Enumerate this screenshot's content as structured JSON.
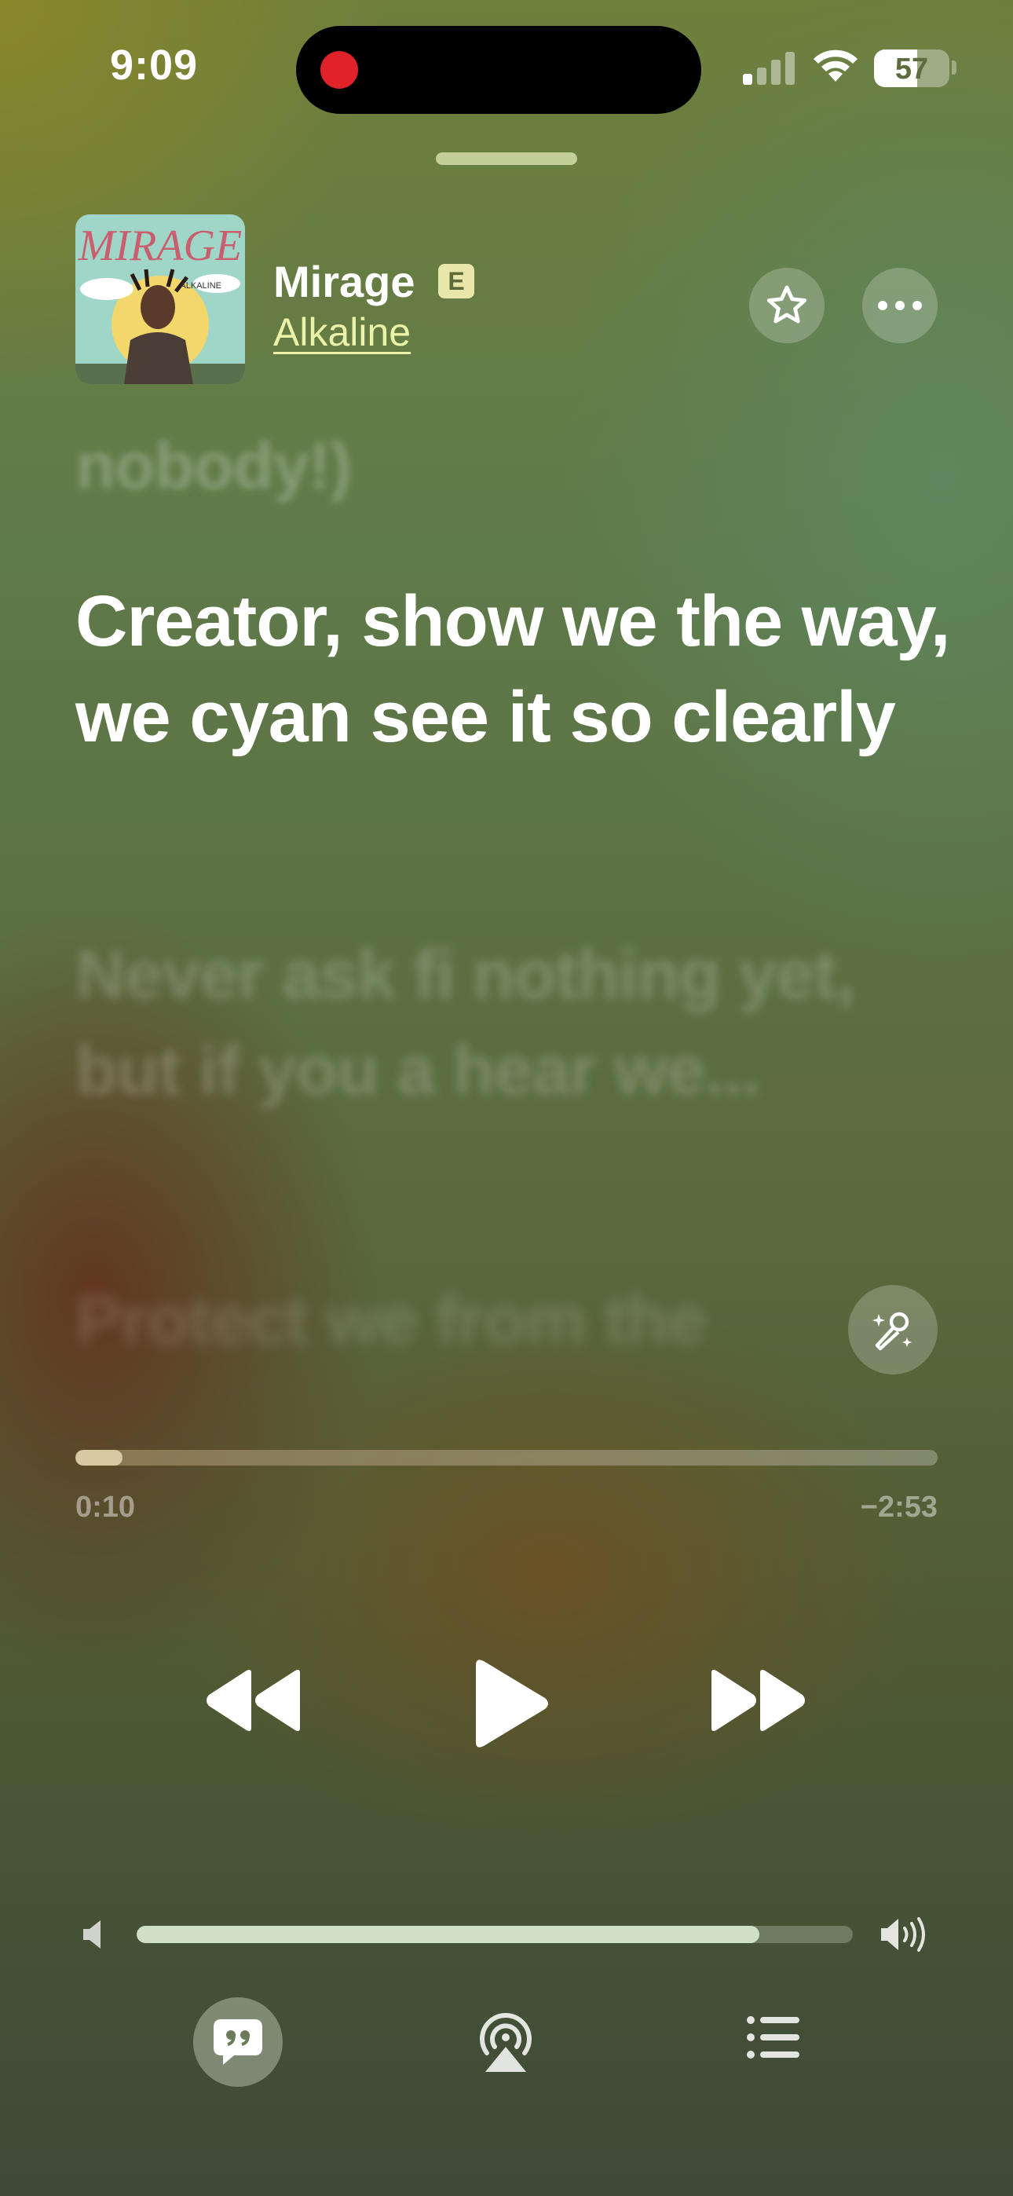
{
  "status_bar": {
    "time": "9:09",
    "battery_level": "57",
    "battery_fraction": 0.57,
    "signal_bars_active": 1,
    "recording_indicator_color": "#e0222a"
  },
  "now_playing": {
    "title": "Mirage",
    "explicit_badge": "E",
    "artist": "Alkaline",
    "artwork": {
      "title_text": "MIRAGE",
      "artist_text": "ALKALINE"
    }
  },
  "lyrics": {
    "previous": "nobody!)",
    "current": "Creator, show we the way, we cyan see it so clearly",
    "next": "Never ask fi nothing yet, but if you a hear we...",
    "after": "Protect we from the"
  },
  "progress": {
    "elapsed": "0:10",
    "remaining": "−2:53",
    "fraction": 0.055
  },
  "volume": {
    "level": 0.87
  },
  "icons": {
    "favorite": "star-icon",
    "more": "ellipsis-icon",
    "sing": "microphone-sparkle-icon",
    "rewind": "rewind-icon",
    "play": "play-icon",
    "forward": "fast-forward-icon",
    "volume_low": "speaker-low-icon",
    "volume_high": "speaker-high-icon",
    "lyrics": "quote-bubble-icon",
    "airplay": "airplay-icon",
    "queue": "list-icon"
  },
  "colors": {
    "accent_artist": "#ecf2a8",
    "progress_fill": "#d8c9a3",
    "volume_fill": "#cfe0c4"
  }
}
